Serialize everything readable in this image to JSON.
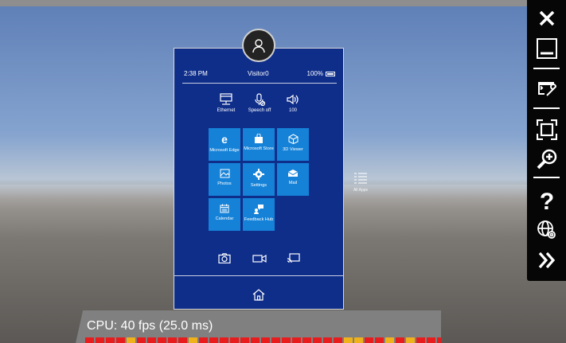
{
  "status": {
    "time": "2:38 PM",
    "user": "Visitor0",
    "battery": "100%"
  },
  "quick_actions": [
    {
      "label": "Ethernet",
      "icon": "ethernet-icon"
    },
    {
      "label": "Speech off",
      "icon": "microphone-off-icon"
    },
    {
      "label": "100",
      "icon": "volume-icon"
    }
  ],
  "tiles": [
    {
      "label": "Microsoft Edge",
      "icon": "edge-icon"
    },
    {
      "label": "Microsoft Store",
      "icon": "store-icon"
    },
    {
      "label": "3D Viewer",
      "icon": "cube-icon"
    },
    {
      "label": "Photos",
      "icon": "photos-icon"
    },
    {
      "label": "Settings",
      "icon": "gear-icon"
    },
    {
      "label": "Mail",
      "icon": "mail-icon"
    },
    {
      "label": "Calendar",
      "icon": "calendar-icon"
    },
    {
      "label": "Feedback Hub",
      "icon": "feedback-icon"
    }
  ],
  "all_apps_label": "All Apps",
  "cpu": {
    "label": "CPU: 40 fps (25.0 ms)"
  },
  "colors": {
    "panel": "#0f2e8a",
    "tile": "#1582d8",
    "bar_red": "#e81c1c",
    "bar_yellow": "#f0b21a"
  }
}
